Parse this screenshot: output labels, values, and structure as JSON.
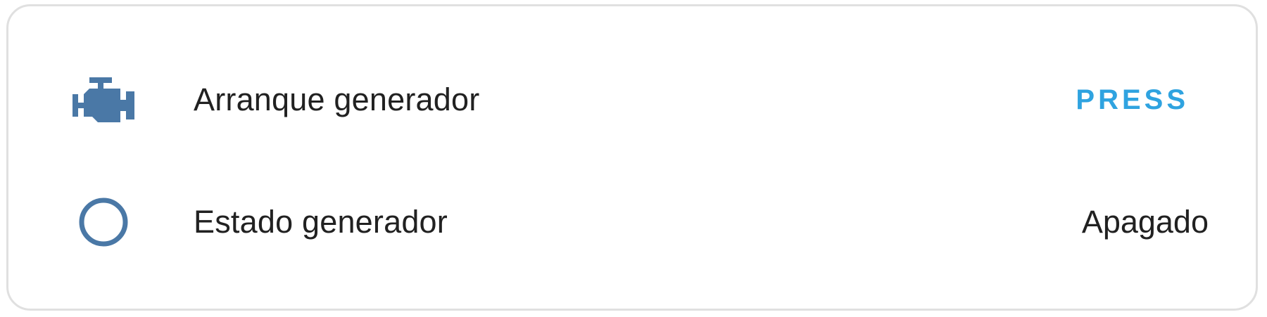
{
  "entities": [
    {
      "icon": "engine-icon",
      "label": "Arranque generador",
      "action_label": "PRESS"
    },
    {
      "icon": "circle-outline-icon",
      "label": "Estado generador",
      "state": "Apagado"
    }
  ],
  "colors": {
    "icon": "#4a78a6",
    "action": "#2fa3e0",
    "text": "#212121",
    "card_border": "#e0e0e0"
  }
}
